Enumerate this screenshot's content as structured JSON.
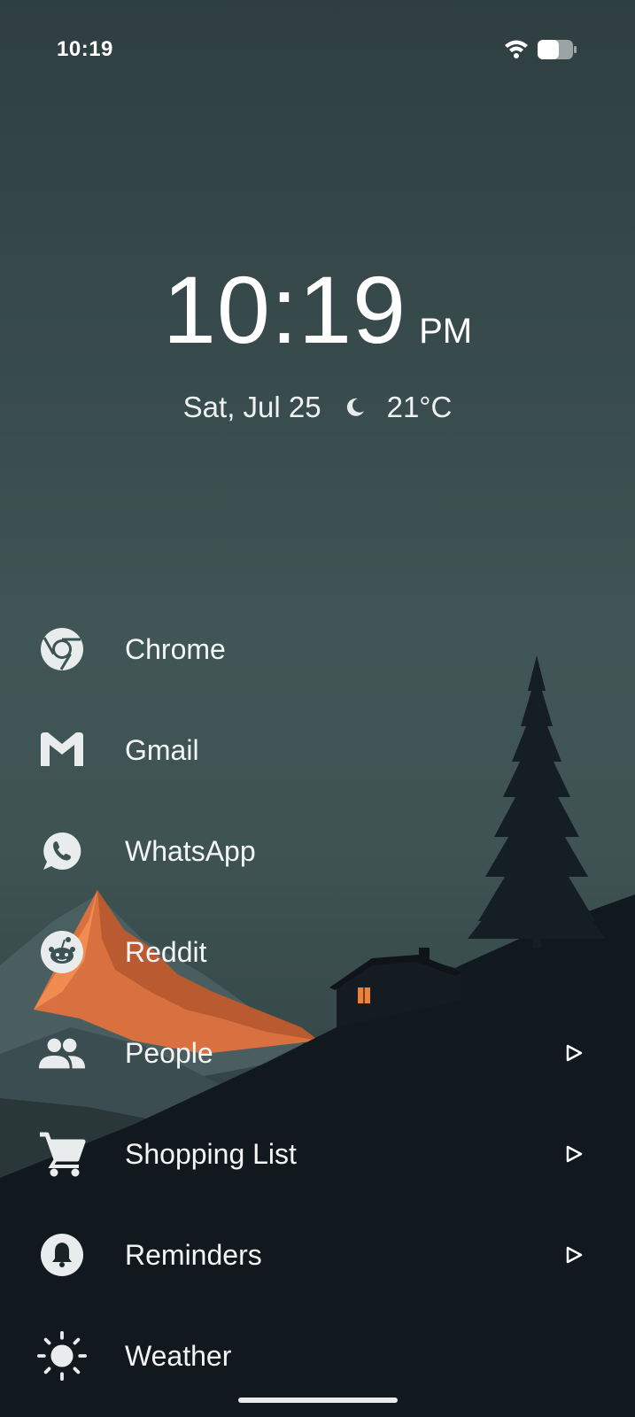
{
  "status_bar": {
    "time": "10:19",
    "wifi_icon": "wifi-icon",
    "battery_icon": "battery-icon"
  },
  "clock": {
    "time": "10:19",
    "ampm": "PM",
    "date": "Sat, Jul 25",
    "weather_icon": "moon-icon",
    "temperature": "21°C"
  },
  "apps": [
    {
      "label": "Chrome",
      "icon": "chrome-icon",
      "has_arrow": false
    },
    {
      "label": "Gmail",
      "icon": "gmail-icon",
      "has_arrow": false
    },
    {
      "label": "WhatsApp",
      "icon": "whatsapp-icon",
      "has_arrow": false
    },
    {
      "label": "Reddit",
      "icon": "reddit-icon",
      "has_arrow": false
    },
    {
      "label": "People",
      "icon": "people-icon",
      "has_arrow": true
    },
    {
      "label": "Shopping List",
      "icon": "cart-icon",
      "has_arrow": true
    },
    {
      "label": "Reminders",
      "icon": "bell-icon",
      "has_arrow": true
    },
    {
      "label": "Weather",
      "icon": "sun-icon",
      "has_arrow": false
    }
  ],
  "colors": {
    "sky": "#3d5252",
    "ground": "#10171c",
    "mountain_glow": "#e07a45",
    "icon": "#e8ecec"
  }
}
